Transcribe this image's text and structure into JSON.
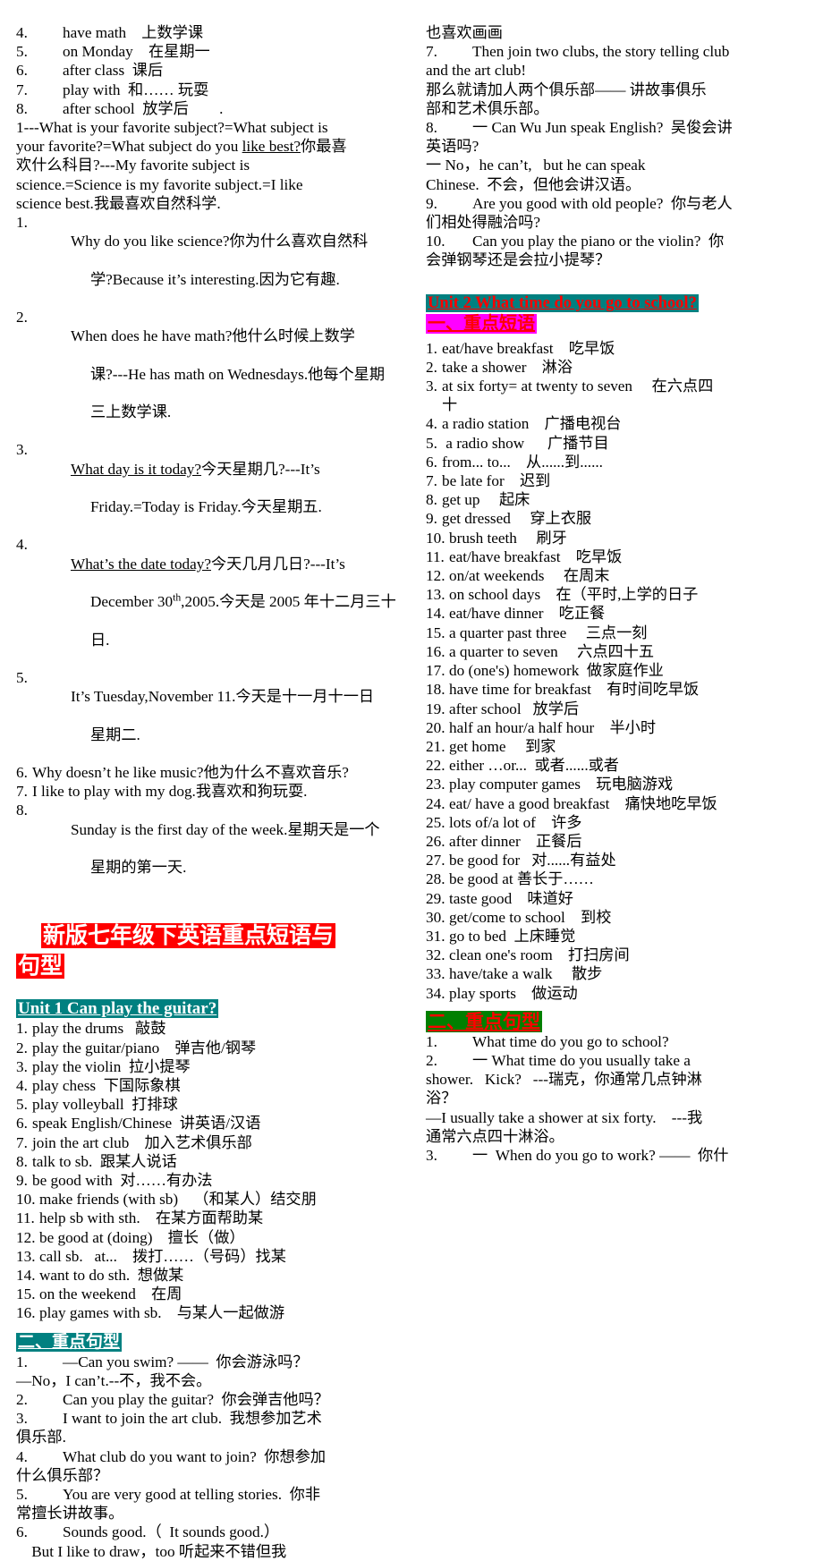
{
  "document": {
    "title": "新版七年级下英语重点短语与句型"
  },
  "left_column": {
    "top_phrase_items": [
      {
        "num": "4.",
        "text": "have math    上数学课"
      },
      {
        "num": "5.",
        "text": "on Monday    在星期一"
      },
      {
        "num": "6.",
        "text": "after class  课后"
      },
      {
        "num": "7.",
        "text": "play with  和…… 玩耍"
      },
      {
        "num": "8.",
        "text": "after school  放学后        ."
      }
    ],
    "paragraph_1": {
      "line1": "1---What is your favorite subject?=What subject is",
      "line2_a": "your favorite?=What subject do you ",
      "line2_u": "like best?",
      "line2_b": "你最喜",
      "line3": "欢什么科目?---My favorite subject is",
      "line4": "science.=Science is my favorite subject.=I like",
      "line5": "science best.我最喜欢自然科学."
    },
    "sentence_items": [
      {
        "num": "1.",
        "lines": [
          "Why do you like science?你为什么喜欢自然科",
          "学?Because it’s interesting.因为它有趣."
        ]
      },
      {
        "num": "2.",
        "lines": [
          "When does he have math?他什么时候上数学",
          "课?---He has math on Wednesdays.他每个星期",
          "三上数学课."
        ]
      },
      {
        "num": "3.",
        "underline_first": "What day is it today?",
        "lines": [
          "今天星期几?---It’s",
          "Friday.=Today is Friday.今天星期五."
        ]
      },
      {
        "num": "4.",
        "underline_first": "What’s the date today?",
        "lines": [
          "今天几月几日?---It’s",
          "December 30th,2005.今天是 2005 年十二月三十",
          "日."
        ],
        "sup": "th"
      },
      {
        "num": "5.",
        "lines": [
          "It’s Tuesday,November 11.今天是十一月十一日",
          "星期二."
        ]
      },
      {
        "num": "6.",
        "lines": [
          "Why doesn’t he like music?他为什么不喜欢音乐?"
        ]
      },
      {
        "num": "7.",
        "lines": [
          "I like to play with my dog.我喜欢和狗玩耍."
        ]
      },
      {
        "num": "8.",
        "lines": [
          "Sunday is the first day of the week.星期天是一个",
          "星期的第一天."
        ]
      }
    ],
    "main_title_line1": "新版七年级下英语重点短语与",
    "main_title_line2": "句型",
    "unit1_heading": "Unit 1 Can play the guitar?",
    "unit1_phrases": [
      {
        "num": "1.",
        "text": "play the drums   敲鼓"
      },
      {
        "num": "2.",
        "text": "play the guitar/piano    弹吉他/钢琴"
      },
      {
        "num": "3.",
        "text": "play the violin  拉小提琴"
      },
      {
        "num": "4.",
        "text": "play chess  下国际象棋"
      },
      {
        "num": "5.",
        "text": "play volleyball  打排球"
      },
      {
        "num": "6.",
        "text": "speak English/Chinese  讲英语/汉语"
      },
      {
        "num": "7.",
        "text": "join the art club    加入艺术俱乐部"
      },
      {
        "num": "8.",
        "text": "talk to sb.  跟某人说话"
      },
      {
        "num": "9.",
        "text": "be good with  对……有办法"
      },
      {
        "num": "10.",
        "text": "make friends (with sb)    （和某人）结交朋"
      },
      {
        "num": "11.",
        "text": "help sb with sth.    在某方面帮助某"
      },
      {
        "num": "12.",
        "text": "be good at (doing)    擅长（做）"
      },
      {
        "num": "13.",
        "text": "call sb.   at...    拨打……（号码）找某"
      },
      {
        "num": "14.",
        "text": "want to do sth.  想做某"
      },
      {
        "num": "15.",
        "text": "on the weekend    在周"
      },
      {
        "num": "16.",
        "text": "play games with sb.    与某人一起做游"
      }
    ],
    "unit1_sentences_heading": "二、重点句型",
    "unit1_sentences": [
      {
        "num": "1.",
        "lines": [
          "—Can you swim? ——  你会游泳吗？",
          "—No，I can’t.--不，我不会。"
        ],
        "hang": false
      },
      {
        "num": "2.",
        "lines": [
          "Can you play the guitar?  你会弹吉他吗？"
        ],
        "hang": false
      },
      {
        "num": "3.",
        "lines": [
          "I want to join the art club.  我想参加艺术",
          "俱乐部."
        ],
        "hang": false
      },
      {
        "num": "4.",
        "lines": [
          "What club do you want to join?  你想参加",
          "什么俱乐部？"
        ],
        "hang": false
      },
      {
        "num": "5.",
        "lines": [
          "You are very good at telling stories.  你非",
          "常擅长讲故事。"
        ],
        "hang": false
      },
      {
        "num": "6.",
        "lines": [
          "Sounds good.（  It sounds good.）",
          "    But I like to draw，too 听起来不错但我"
        ],
        "hang": false
      }
    ]
  },
  "right_column": {
    "continuation_line": "也喜欢画画",
    "items": [
      {
        "num": "7.",
        "lines": [
          "Then join two clubs, the story telling club",
          "and the art club!",
          "那么就请加人两个俱乐部—— 讲故事俱乐",
          "部和艺术俱乐部。"
        ]
      },
      {
        "num": "8.",
        "lines": [
          "一 Can Wu Jun speak English?  吴俊会讲",
          "英语吗?",
          "一 No，he can’t,   but he can speak",
          "Chinese.  不会，但他会讲汉语。"
        ]
      },
      {
        "num": "9.",
        "lines": [
          "Are you good with old people?  你与老人",
          "们相处得融洽吗?"
        ]
      },
      {
        "num": "10.",
        "lines": [
          "Can you play the piano or the violin?  你",
          "会弹钢琴还是会拉小提琴？"
        ]
      }
    ],
    "unit2_heading": "Unit 2   What time do you go to school?",
    "unit2_phrases_heading": "一、重点短语",
    "unit2_phrases": [
      {
        "num": "1.",
        "text": "eat/have breakfast    吃早饭"
      },
      {
        "num": "2.",
        "text": "take a shower    淋浴"
      },
      {
        "num": "3.",
        "text": "at six forty= at twenty to seven     在六点四\n十"
      },
      {
        "num": "4.",
        "text": "a radio station    广播电视台"
      },
      {
        "num": "5.",
        "text": " a radio show      广播节目"
      },
      {
        "num": "6.",
        "text": "from... to...    从......到......"
      },
      {
        "num": "7.",
        "text": "be late for    迟到"
      },
      {
        "num": "8.",
        "text": "get up     起床"
      },
      {
        "num": "9.",
        "text": "get dressed     穿上衣服"
      },
      {
        "num": "10.",
        "text": "brush teeth     刷牙"
      },
      {
        "num": "11.",
        "text": "eat/have breakfast    吃早饭"
      },
      {
        "num": "12.",
        "text": "on/at weekends     在周末"
      },
      {
        "num": "13.",
        "text": "on school days    在（平时,上学的日子"
      },
      {
        "num": "14.",
        "text": "eat/have dinner    吃正餐"
      },
      {
        "num": "15.",
        "text": "a quarter past three     三点一刻"
      },
      {
        "num": "16.",
        "text": "a quarter to seven     六点四十五"
      },
      {
        "num": "17.",
        "text": "do (one's) homework  做家庭作业"
      },
      {
        "num": "18.",
        "text": "have time for breakfast    有时间吃早饭"
      },
      {
        "num": "19.",
        "text": "after school   放学后"
      },
      {
        "num": "20.",
        "text": "half an hour/a half hour    半小时"
      },
      {
        "num": "21.",
        "text": "get home     到家"
      },
      {
        "num": "22.",
        "text": "either …or...  或者......或者"
      },
      {
        "num": "23.",
        "text": "play computer games    玩电脑游戏"
      },
      {
        "num": "24.",
        "text": "eat/ have a good breakfast    痛快地吃早饭"
      },
      {
        "num": "25.",
        "text": "lots of/a lot of    许多"
      },
      {
        "num": "26.",
        "text": "after dinner    正餐后"
      },
      {
        "num": "27.",
        "text": "be good for   对......有益处"
      },
      {
        "num": "28.",
        "text": "be good at 善长于……"
      },
      {
        "num": "29.",
        "text": "taste good    味道好"
      },
      {
        "num": "30.",
        "text": "get/come to school    到校"
      },
      {
        "num": "31.",
        "text": "go to bed  上床睡觉"
      },
      {
        "num": "32.",
        "text": "clean one's room    打扫房间"
      },
      {
        "num": "33.",
        "text": "have/take a walk     散步"
      },
      {
        "num": "34.",
        "text": "play sports    做运动"
      }
    ],
    "unit2_sentences_heading": "二、重点句型",
    "unit2_sentences": [
      {
        "num": "1.",
        "lines": [
          "What time do you go to school?"
        ]
      },
      {
        "num": "2.",
        "lines": [
          "一 What time do you usually take a",
          "shower.   Kick?   ---瑞克，你通常几点钟淋",
          "浴？",
          "—I usually take a shower at six forty.    ---我",
          "通常六点四十淋浴。"
        ]
      },
      {
        "num": "3.",
        "lines": [
          "一  When do you go to work? ——  你什"
        ]
      }
    ]
  }
}
